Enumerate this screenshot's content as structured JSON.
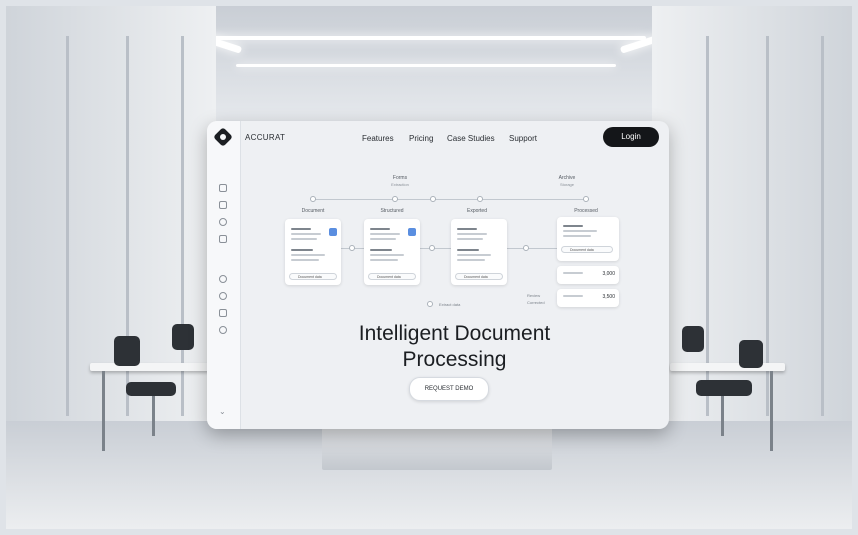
{
  "app": {
    "brand": "ACCURAT",
    "login_label": "Login"
  },
  "nav": {
    "items": [
      "Features",
      "Pricing",
      "Case Studies",
      "Support"
    ]
  },
  "flow": {
    "top_labels": [
      {
        "title": "Forms",
        "sub": "Extraction"
      },
      {
        "title": "Archive",
        "sub": "Storage"
      }
    ],
    "stages": [
      "Document",
      "Structured",
      "Exported",
      "Processed"
    ],
    "review_label": "Review",
    "review_sub": "Corrected",
    "footer_hint": "Extract data"
  },
  "cards": {
    "pill_label": "Document data",
    "amounts": [
      "3,000",
      "3,500"
    ]
  },
  "hero": {
    "line1": "Intelligent Document",
    "line2": "Processing",
    "cta_label": "REQUEST DEMO"
  }
}
